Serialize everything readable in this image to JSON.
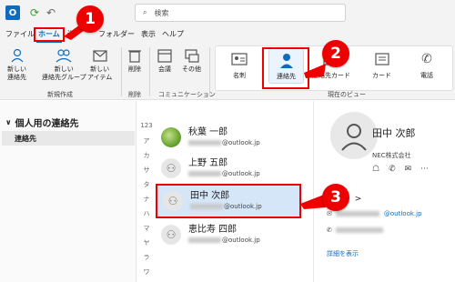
{
  "titlebar": {
    "app_icon": "O",
    "search_placeholder": "検索"
  },
  "menu": {
    "tabs": [
      "ファイル",
      "ホーム",
      "送",
      "フォルダー",
      "表示",
      "ヘルプ"
    ]
  },
  "ribbon": {
    "new_contact": "新しい\n連絡先",
    "new_group": "新しい\n連絡先グループ",
    "new_item": "新しい\nアイテム",
    "new_group_label": "新規作成",
    "delete": "削除",
    "delete_group_label": "削除",
    "meeting": "会議",
    "other": "その他",
    "comm_group_label": "コミュニケーション",
    "view": {
      "business_card": "名刺",
      "contact": "連絡先",
      "contact_card": "連絡先カード",
      "card": "カード",
      "phone": "電話",
      "group_label": "現在のビュー"
    }
  },
  "nav": {
    "header": "個人用の連絡先",
    "item": "連絡先"
  },
  "index": [
    "123",
    "ア",
    "カ",
    "サ",
    "タ",
    "ナ",
    "ハ",
    "マ",
    "ヤ",
    "ラ",
    "ワ"
  ],
  "contacts": [
    {
      "name": "秋葉 一郎",
      "email_domain": "@outlook.jp"
    },
    {
      "name": "上野 五郎",
      "email_domain": "@outlook.jp"
    },
    {
      "name": "田中 次郎",
      "email_domain": "@outlook.jp"
    },
    {
      "name": "恵比寿 四郎",
      "email_domain": "@outlook.jp"
    }
  ],
  "detail": {
    "name": "田中 次郎",
    "company": "NEC株式会社",
    "tab": "先",
    "email_domain": "@outlook.jp",
    "more": "詳細を表示"
  },
  "callouts": [
    "1",
    "2",
    "3"
  ],
  "colors": {
    "accent": "#0f6cbd",
    "callout": "#ee0000"
  }
}
